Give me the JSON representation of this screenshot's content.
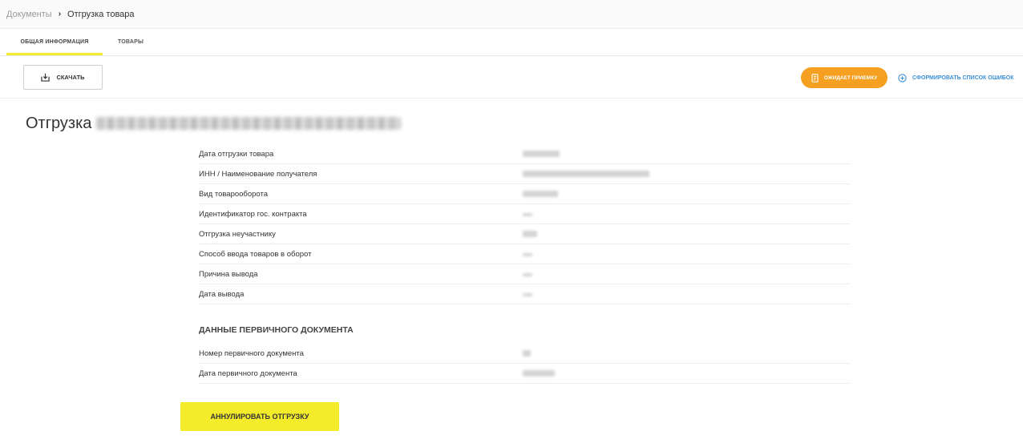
{
  "breadcrumb": {
    "parent": "Документы",
    "separator": "›",
    "current": "Отгрузка товара"
  },
  "tabs": [
    {
      "label": "Общая информация",
      "active": true
    },
    {
      "label": "Товары",
      "active": false
    }
  ],
  "toolbar": {
    "download_label": "Скачать",
    "status_label": "Ожидает приемку",
    "errors_label": "Сформировать список ошибок"
  },
  "title": {
    "prefix": "Отгрузка"
  },
  "fields": [
    {
      "label": "Дата отгрузки товара"
    },
    {
      "label": "ИНН / Наименование получателя"
    },
    {
      "label": "Вид товарооборота"
    },
    {
      "label": "Идентификатор гос. контракта"
    },
    {
      "label": "Отгрузка неучастнику"
    },
    {
      "label": "Способ ввода товаров в оборот"
    },
    {
      "label": "Причина вывода"
    },
    {
      "label": "Дата вывода"
    }
  ],
  "primary_doc": {
    "section_title": "Данные первичного документа",
    "fields": [
      {
        "label": "Номер первичного документа"
      },
      {
        "label": "Дата первичного документа"
      }
    ]
  },
  "cancel_button": "Аннулировать отгрузку",
  "colors": {
    "accent_yellow": "#f4ec2b",
    "status_orange": "#f5a020",
    "link_blue": "#3c8fd6"
  },
  "icons": {
    "download": "download-icon",
    "status": "document-clock-icon",
    "errors": "plus-circle-icon"
  }
}
